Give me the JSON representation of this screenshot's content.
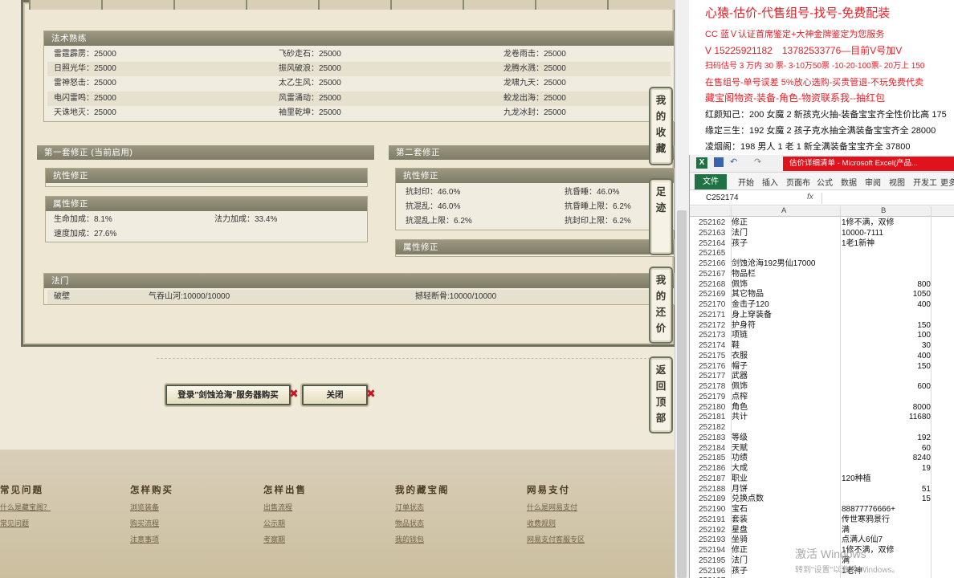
{
  "skills": {
    "title": "法术熟练",
    "rows": [
      [
        "雷霆霹雳：25000",
        "飞砂走石：25000",
        "龙卷雨击：25000"
      ],
      [
        "日照光华：25000",
        "振风破浪：25000",
        "龙腾水溅：25000"
      ],
      [
        "雷神怒击：25000",
        "太乙生风：25000",
        "龙啸九天：25000"
      ],
      [
        "电闪雷鸣：25000",
        "风雷涌动：25000",
        "蛟龙出海：25000"
      ],
      [
        "天诛地灭：25000",
        "袖里乾坤：25000",
        "九龙冰封：25000"
      ]
    ]
  },
  "set1": {
    "title": "第一套修正 (当前启用)",
    "resist_title": "抗性修正",
    "attr_title": "属性修正",
    "attrs": [
      "生命加成：8.1%",
      "法力加成：33.4%",
      "速度加成：27.6%"
    ]
  },
  "set2": {
    "title": "第二套修正",
    "resist_title": "抗性修正",
    "attr_title": "属性修正",
    "resists": [
      "抗封印：46.0%",
      "抗昏睡：46.0%",
      "抗混乱：46.0%",
      "抗昏睡上限：6.2%",
      "抗混乱上限：6.2%",
      "抗封印上限：6.2%"
    ]
  },
  "sect": {
    "title": "法门",
    "items": [
      "破壁",
      "气吞山河:10000/10000",
      "撼轻断骨:10000/10000"
    ]
  },
  "buttons": {
    "login": "登录\"剑蚀沧海\"服务器购买",
    "close": "关闭"
  },
  "side": [
    "我的收藏",
    "足迹",
    "我的还价",
    "返回顶部"
  ],
  "footer": [
    {
      "title": "常见问题",
      "links": [
        "什么是藏宝阁？",
        "常见问题"
      ]
    },
    {
      "title": "怎样购买",
      "links": [
        "浏览装备",
        "购买流程",
        "注意事项"
      ]
    },
    {
      "title": "怎样出售",
      "links": [
        "出售流程",
        "公示期",
        "考察期"
      ]
    },
    {
      "title": "我的藏宝阁",
      "links": [
        "订单状态",
        "物品状态",
        "我的钱包"
      ]
    },
    {
      "title": "网易支付",
      "links": [
        "什么是网易支付",
        "收费规则",
        "网易支付客服专区"
      ]
    }
  ],
  "notes": [
    "心猿-估价-代售组号-找号-免费配装",
    "CC 蓝Ｖ认证首席鉴定+大神金牌鉴定为您服务",
    "V 15225921182　13782533776—目前V号加V",
    "扫码估号 3 万内 30 票- 3-10万50票 -10-20-100票- 20万上 150",
    "在售组号-单号误差 5%放心选购-买贵管退-不玩免费代卖",
    "藏宝阁物资-装备-角色-物资联系我--抽红包",
    "红颜知己：200 女魔 2 新孩克火抽-装备宝宝齐全性价比高 175",
    "缘定三生：192 女魔 2 孩子克水抽全满装备宝宝齐全 28000",
    "凌烟阁：198 男人 1 老 1 新全满装备宝宝齐全 37800"
  ],
  "excel": {
    "title": "估价详细清单 - Microsoft Excel(产品...",
    "tabs": [
      "文件",
      "开始",
      "插入",
      "页面布",
      "公式",
      "数据",
      "审阅",
      "视图",
      "开发工",
      "更多"
    ],
    "namebox": "C252174",
    "fx": "fx",
    "col_a": "A",
    "col_b": "B",
    "rows": [
      [
        "252162",
        "修正",
        "1修不满，双修"
      ],
      [
        "252163",
        "法门",
        "10000-7111"
      ],
      [
        "252164",
        "孩子",
        "1老1新神"
      ],
      [
        "252165",
        "",
        ""
      ],
      [
        "252166",
        "剑蚀沧海192男仙17000",
        ""
      ],
      [
        "252167",
        "物品栏",
        ""
      ],
      [
        "252168",
        "佩饰",
        "800"
      ],
      [
        "252169",
        "其它物品",
        "1050"
      ],
      [
        "252170",
        "金击子120",
        "400"
      ],
      [
        "252171",
        "身上穿装备",
        ""
      ],
      [
        "252172",
        "护身符",
        "150"
      ],
      [
        "252173",
        "项链",
        "100"
      ],
      [
        "252174",
        "鞋",
        "30"
      ],
      [
        "252175",
        "衣服",
        "400"
      ],
      [
        "252176",
        "帽子",
        "150"
      ],
      [
        "252177",
        "武器",
        ""
      ],
      [
        "252178",
        "佩饰",
        "600"
      ],
      [
        "252179",
        "点榨",
        ""
      ],
      [
        "252180",
        "角色",
        "8000"
      ],
      [
        "252181",
        "共计",
        "11680"
      ],
      [
        "252182",
        "",
        ""
      ],
      [
        "252183",
        "等级",
        "192"
      ],
      [
        "252184",
        "天赋",
        "60"
      ],
      [
        "252185",
        "功绩",
        "8240"
      ],
      [
        "252186",
        "大成",
        "19"
      ],
      [
        "252187",
        "职业",
        "120种植"
      ],
      [
        "252188",
        "月饼",
        "51"
      ],
      [
        "252189",
        "兑换点数",
        "15"
      ],
      [
        "252190",
        "宝石",
        "88877776666+"
      ],
      [
        "252191",
        "套装",
        "传世寒鸦景行"
      ],
      [
        "252192",
        "星盘",
        "满"
      ],
      [
        "252193",
        "坐骑",
        "点满人6仙7"
      ],
      [
        "252194",
        "修正",
        "1修不满，双修"
      ],
      [
        "252195",
        "法门",
        "满"
      ],
      [
        "252196",
        "孩子",
        "1老神"
      ],
      [
        "252197",
        "",
        ""
      ]
    ]
  },
  "watermark": "激活 Windows",
  "watermark_sub": "转到\"设置\"以激活 Windows。"
}
